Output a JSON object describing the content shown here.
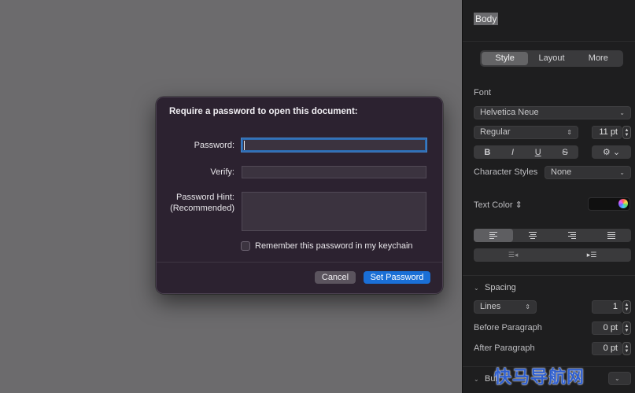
{
  "dialog": {
    "title": "Require a password to open this document:",
    "password_label": "Password:",
    "password_value": "",
    "verify_label": "Verify:",
    "verify_value": "",
    "hint_label_line1": "Password Hint:",
    "hint_label_line2": "(Recommended)",
    "hint_value": "",
    "keychain_label": "Remember this password in my keychain",
    "keychain_checked": false,
    "cancel_label": "Cancel",
    "set_label": "Set Password"
  },
  "inspector": {
    "paragraph_style": "Body",
    "tabs": [
      {
        "label": "Style",
        "active": true
      },
      {
        "label": "Layout",
        "active": false
      },
      {
        "label": "More",
        "active": false
      }
    ],
    "font_label": "Font",
    "font_family": "Helvetica Neue",
    "font_weight": "Regular",
    "font_size": "11 pt",
    "style_buttons": [
      "B",
      "I",
      "U",
      "S"
    ],
    "character_styles_label": "Character Styles",
    "character_styles_value": "None",
    "text_color_label": "Text Color ⇕",
    "spacing_label": "Spacing",
    "spacing_mode": "Lines",
    "spacing_value": "1",
    "before_paragraph_label": "Before Paragraph",
    "before_paragraph_value": "0 pt",
    "after_paragraph_label": "After Paragraph",
    "after_paragraph_value": "0 pt",
    "bullets_label": "Bul",
    "accent_color": "#1a6fd6",
    "focus_ring_color": "#2d6bb0"
  },
  "watermark": {
    "text": "快马导航网",
    "color": "#2f5fcf"
  }
}
